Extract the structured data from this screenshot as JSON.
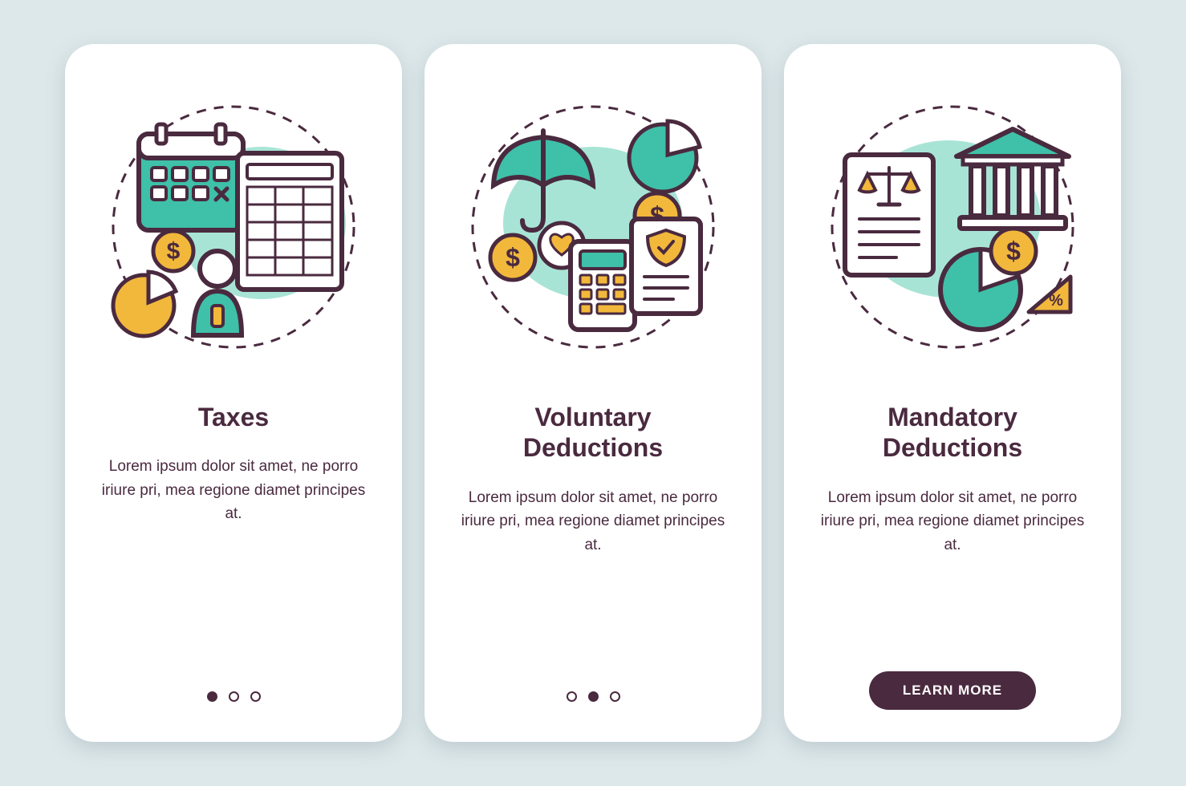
{
  "colors": {
    "bg": "#dde8ea",
    "card": "#ffffff",
    "text": "#4a2a3f",
    "accent_teal": "#3fc0a8",
    "accent_teal_light": "#a8e4d6",
    "accent_yellow": "#f2b83b",
    "stroke_dark": "#4a2a3f"
  },
  "cards": [
    {
      "title": "Taxes",
      "desc": "Lorem ipsum dolor sit amet, ne porro iriure pri, mea regione diamet principes at.",
      "icon": "taxes-icon",
      "activeDot": 0,
      "hasCta": false
    },
    {
      "title": "Voluntary\nDeductions",
      "desc": "Lorem ipsum dolor sit amet, ne porro iriure pri, mea regione diamet principes at.",
      "icon": "voluntary-deductions-icon",
      "activeDot": 1,
      "hasCta": false
    },
    {
      "title": "Mandatory\nDeductions",
      "desc": "Lorem ipsum dolor sit amet, ne porro iriure pri, mea regione diamet principes at.",
      "icon": "mandatory-deductions-icon",
      "activeDot": 2,
      "hasCta": true
    }
  ],
  "cta_label": "LEARN MORE"
}
